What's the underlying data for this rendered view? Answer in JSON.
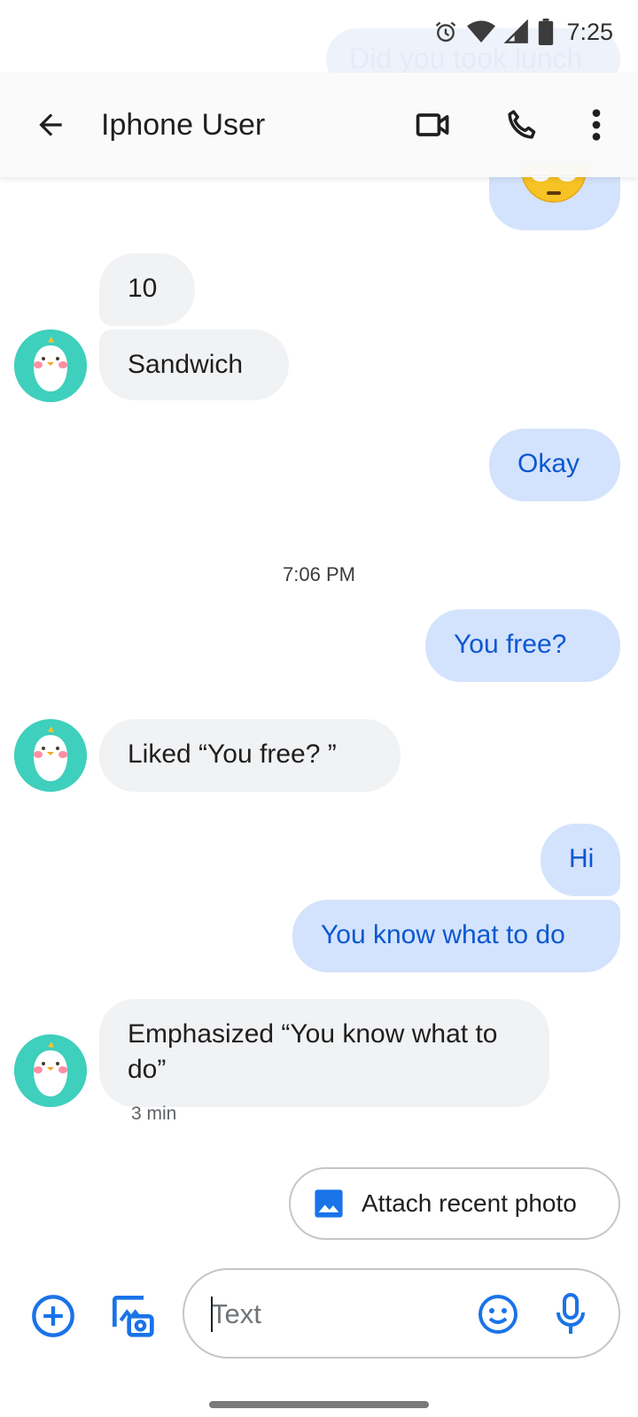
{
  "status_bar": {
    "time": "7:25",
    "icons": [
      "alarm-icon",
      "wifi-icon",
      "signal-icon",
      "battery-icon"
    ]
  },
  "ghost_message": "Did you took lunch",
  "header": {
    "contact_name": "Iphone User",
    "back_icon": "arrow-back-icon",
    "video_icon": "videocam-icon",
    "call_icon": "phone-icon",
    "more_icon": "more-vert-icon"
  },
  "messages": [
    {
      "direction": "out",
      "text": "",
      "emoji": "unamused-face"
    },
    {
      "direction": "in",
      "text": "10"
    },
    {
      "direction": "in",
      "text": "Sandwich"
    },
    {
      "direction": "out",
      "text": "Okay"
    },
    {
      "direction": "out",
      "text": "You free?"
    },
    {
      "direction": "in",
      "text": "Liked “You free? ”"
    },
    {
      "direction": "out",
      "text": "Hi"
    },
    {
      "direction": "out",
      "text": "You know what to do"
    },
    {
      "direction": "in",
      "text": "Emphasized “You know what to do”"
    }
  ],
  "timestamp": "7:06 PM",
  "last_message_age": "3 min",
  "suggestion_chip": {
    "label": "Attach recent photo",
    "icon": "image-icon"
  },
  "compose": {
    "placeholder": "Text"
  },
  "colors": {
    "outgoing_bubble": "#d3e3fd",
    "outgoing_text": "#0b57d0",
    "incoming_bubble": "#f1f2f4",
    "accent": "#0b57d0",
    "avatar_bg": "#3fcfbd"
  }
}
